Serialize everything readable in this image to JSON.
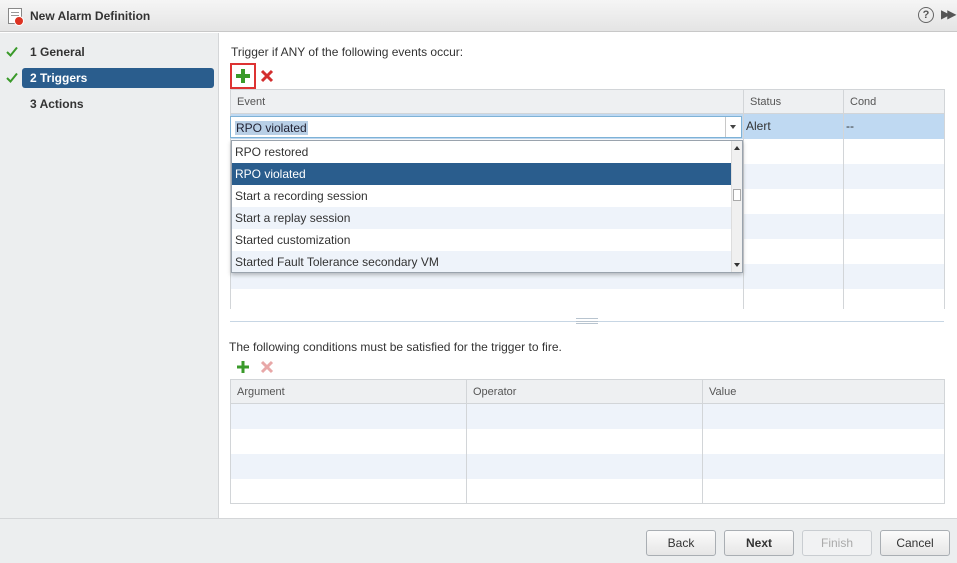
{
  "window": {
    "title": "New Alarm Definition",
    "help_icon": "?",
    "expand_icon": "▶▶"
  },
  "steps": [
    {
      "label": "1  General",
      "completed": true,
      "active": false
    },
    {
      "label": "2  Triggers",
      "completed": true,
      "active": true
    },
    {
      "label": "3  Actions",
      "completed": false,
      "active": false
    }
  ],
  "triggers": {
    "heading": "Trigger if ANY of the following events occur:",
    "columns": [
      "Event",
      "Status",
      "Cond"
    ],
    "row": {
      "event": "RPO violated",
      "status": "Alert",
      "cond": "--"
    },
    "dropdown_options": [
      "RPO restored",
      "RPO violated",
      "Start a recording session",
      "Start a replay session",
      "Started customization",
      "Started Fault Tolerance secondary VM"
    ],
    "dropdown_selected_index": 1
  },
  "conditions": {
    "heading": "The following conditions must be satisfied for the trigger to fire.",
    "columns": [
      "Argument",
      "Operator",
      "Value"
    ]
  },
  "footer": {
    "back": "Back",
    "next": "Next",
    "finish": "Finish",
    "cancel": "Cancel"
  },
  "icons": {
    "add": "plus-icon",
    "remove": "x-icon",
    "check": "check-icon"
  },
  "colors": {
    "accent": "#2a5d8d",
    "add_green": "#3a9a2a",
    "remove_red": "#d32f2f",
    "selection": "#bfd9f2"
  }
}
